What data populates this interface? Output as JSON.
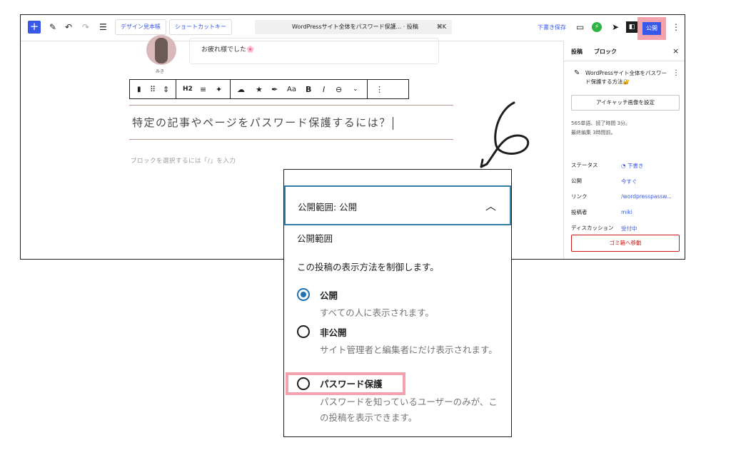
{
  "toolbar": {
    "add_icon": "plus-icon",
    "pill_pattern": "デザイン見本帳",
    "pill_shortcut": "ショートカットキー",
    "command_title": "WordPressサイト全体をパスワード保護...",
    "command_type": "· 投稿",
    "command_key": "⌘K",
    "save_draft": "下書き保存",
    "publish": "公開",
    "accent_color": "#3858e9",
    "highlight_color": "#f2a3ad"
  },
  "editor": {
    "avatar_name": "みき",
    "bubble_text": "お疲れ様でした🌸",
    "heading_level": "H2",
    "heading_text": "特定の記事やページをパスワード保護するには？",
    "block_hint": "ブロックを選択するには「/」を入力"
  },
  "sidebar": {
    "tab_post": "投稿",
    "tab_block": "ブロック",
    "post_title": "WordPressサイト全体をパスワード保護する方法🔐",
    "featured_image": "アイキャッチ画像を設定",
    "words_line": "565単語、読了時間 3分。",
    "edited_line": "最終編集 3時間前。",
    "rows": [
      {
        "label": "ステータス",
        "value": "下書き"
      },
      {
        "label": "公開",
        "value": "今すぐ"
      },
      {
        "label": "リンク",
        "value": "/wordpresspassw..."
      },
      {
        "label": "投稿者",
        "value": "miki"
      },
      {
        "label": "ディスカッション",
        "value": "受付中"
      }
    ],
    "trash": "ゴミ箱へ移動"
  },
  "popover": {
    "header": "公開範囲: 公開",
    "section": "公開範囲",
    "description": "この投稿の表示方法を制御します。",
    "options": [
      {
        "label": "公開",
        "help": "すべての人に表示されます。",
        "checked": true
      },
      {
        "label": "非公開",
        "help": "サイト管理者と編集者にだけ表示されます。",
        "checked": false
      },
      {
        "label": "パスワード保護",
        "help": "パスワードを知っているユーザーのみが、この投稿を表示できます。",
        "checked": false
      }
    ]
  }
}
